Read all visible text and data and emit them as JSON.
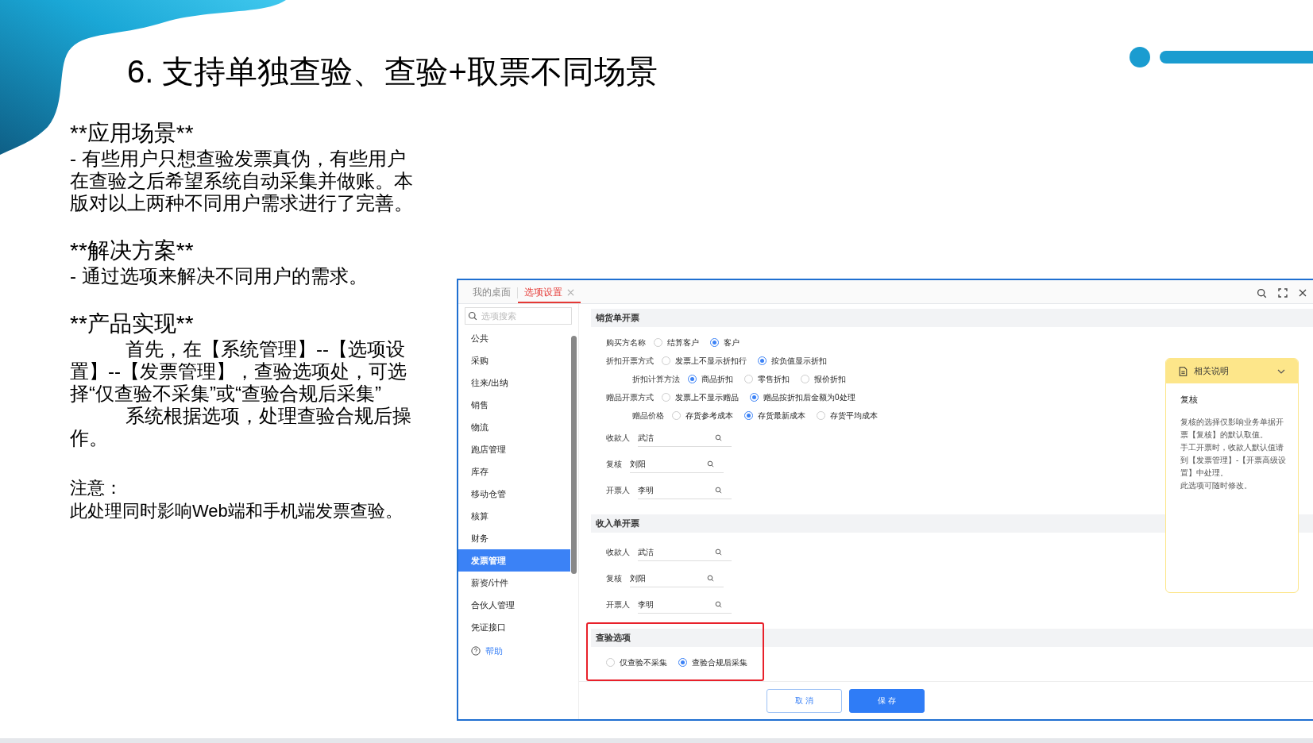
{
  "slide": {
    "title": "6. 支持单独查验、查验+取票不同场景",
    "sections": [
      {
        "heading": "**应用场景**",
        "paragraphs": [
          {
            "kind": "plain",
            "text": "- 有些用户只想查验发票真伪，有些用户在查验之后希望系统自动采集并做账。本版对以上两种不同用户需求进行了完善。"
          }
        ]
      },
      {
        "heading": "**解决方案**",
        "paragraphs": [
          {
            "kind": "plain",
            "text": "- 通过选项来解决不同用户的需求。"
          }
        ]
      },
      {
        "heading": "**产品实现**",
        "paragraphs": [
          {
            "kind": "indented",
            "text": "首先，在【系统管理】--【选项设置】--【发票管理】，查验选项处，可选择“仅查验不采集”或“查验合规后采集”"
          },
          {
            "kind": "indented",
            "text": "系统根据选项，处理查验合规后操作。"
          }
        ]
      }
    ],
    "note": {
      "label": "注意：",
      "text": "此处理同时影响Web端和手机端发票查验。"
    }
  },
  "app": {
    "tabs": [
      {
        "label": "我的桌面",
        "selected": false,
        "closable": false
      },
      {
        "label": "选项设置",
        "selected": true,
        "closable": true
      }
    ],
    "sidebar": {
      "search_placeholder": "选项搜索",
      "items": [
        {
          "label": "公共",
          "selected": false
        },
        {
          "label": "采购",
          "selected": false
        },
        {
          "label": "往来/出纳",
          "selected": false
        },
        {
          "label": "销售",
          "selected": false
        },
        {
          "label": "物流",
          "selected": false
        },
        {
          "label": "跑店管理",
          "selected": false
        },
        {
          "label": "库存",
          "selected": false
        },
        {
          "label": "移动仓管",
          "selected": false
        },
        {
          "label": "核算",
          "selected": false
        },
        {
          "label": "财务",
          "selected": false
        },
        {
          "label": "发票管理",
          "selected": true
        },
        {
          "label": "薪资/计件",
          "selected": false
        },
        {
          "label": "合伙人管理",
          "selected": false
        },
        {
          "label": "凭证接口",
          "selected": false
        }
      ],
      "help": "帮助"
    },
    "sections": [
      {
        "title": "销货单开票",
        "highlighted": false,
        "rows": [
          {
            "kind": "radio",
            "label": "购买方名称",
            "options": [
              {
                "label": "结算客户",
                "selected": false
              },
              {
                "label": "客户",
                "selected": true
              }
            ]
          },
          {
            "kind": "radio",
            "label": "折扣开票方式",
            "options": [
              {
                "label": "发票上不显示折扣行",
                "selected": false
              },
              {
                "label": "按负值显示折扣",
                "selected": true
              }
            ],
            "children": [
              {
                "kind": "radio",
                "label": "折扣计算方法",
                "options": [
                  {
                    "label": "商品折扣",
                    "selected": true
                  },
                  {
                    "label": "零售折扣",
                    "selected": false
                  },
                  {
                    "label": "报价折扣",
                    "selected": false
                  }
                ]
              }
            ]
          },
          {
            "kind": "radio",
            "label": "赠品开票方式",
            "options": [
              {
                "label": "发票上不显示赠品",
                "selected": false
              },
              {
                "label": "赠品按折扣后金额为0处理",
                "selected": true
              }
            ],
            "children": [
              {
                "kind": "radio",
                "label": "赠品价格",
                "options": [
                  {
                    "label": "存货参考成本",
                    "selected": false
                  },
                  {
                    "label": "存货最新成本",
                    "selected": true
                  },
                  {
                    "label": "存货平均成本",
                    "selected": false
                  }
                ]
              }
            ]
          },
          {
            "kind": "field",
            "label": "收款人",
            "value": "武洁"
          },
          {
            "kind": "field",
            "label": "复核",
            "value": "刘阳"
          },
          {
            "kind": "field",
            "label": "开票人",
            "value": "李明"
          }
        ]
      },
      {
        "title": "收入单开票",
        "highlighted": false,
        "rows": [
          {
            "kind": "field",
            "label": "收款人",
            "value": "武洁"
          },
          {
            "kind": "field",
            "label": "复核",
            "value": "刘阳"
          },
          {
            "kind": "field",
            "label": "开票人",
            "value": "李明"
          }
        ]
      },
      {
        "title": "查验选项",
        "highlighted": true,
        "rows": [
          {
            "kind": "radio",
            "options": [
              {
                "label": "仅查验不采集",
                "selected": false
              },
              {
                "label": "查验合规后采集",
                "selected": true
              }
            ]
          }
        ]
      }
    ],
    "info_panel": {
      "title": "相关说明",
      "heading": "复核",
      "paragraphs": [
        "复核的选择仅影响业务单据开票【复核】的默认取值。",
        "手工开票时，收款人默认值请到【发票管理】-【开票高级设置】中处理。",
        "此选项可随时修改。"
      ]
    },
    "buttons": [
      {
        "label": "取 消",
        "kind": "secondary"
      },
      {
        "label": "保 存",
        "kind": "primary"
      }
    ]
  }
}
